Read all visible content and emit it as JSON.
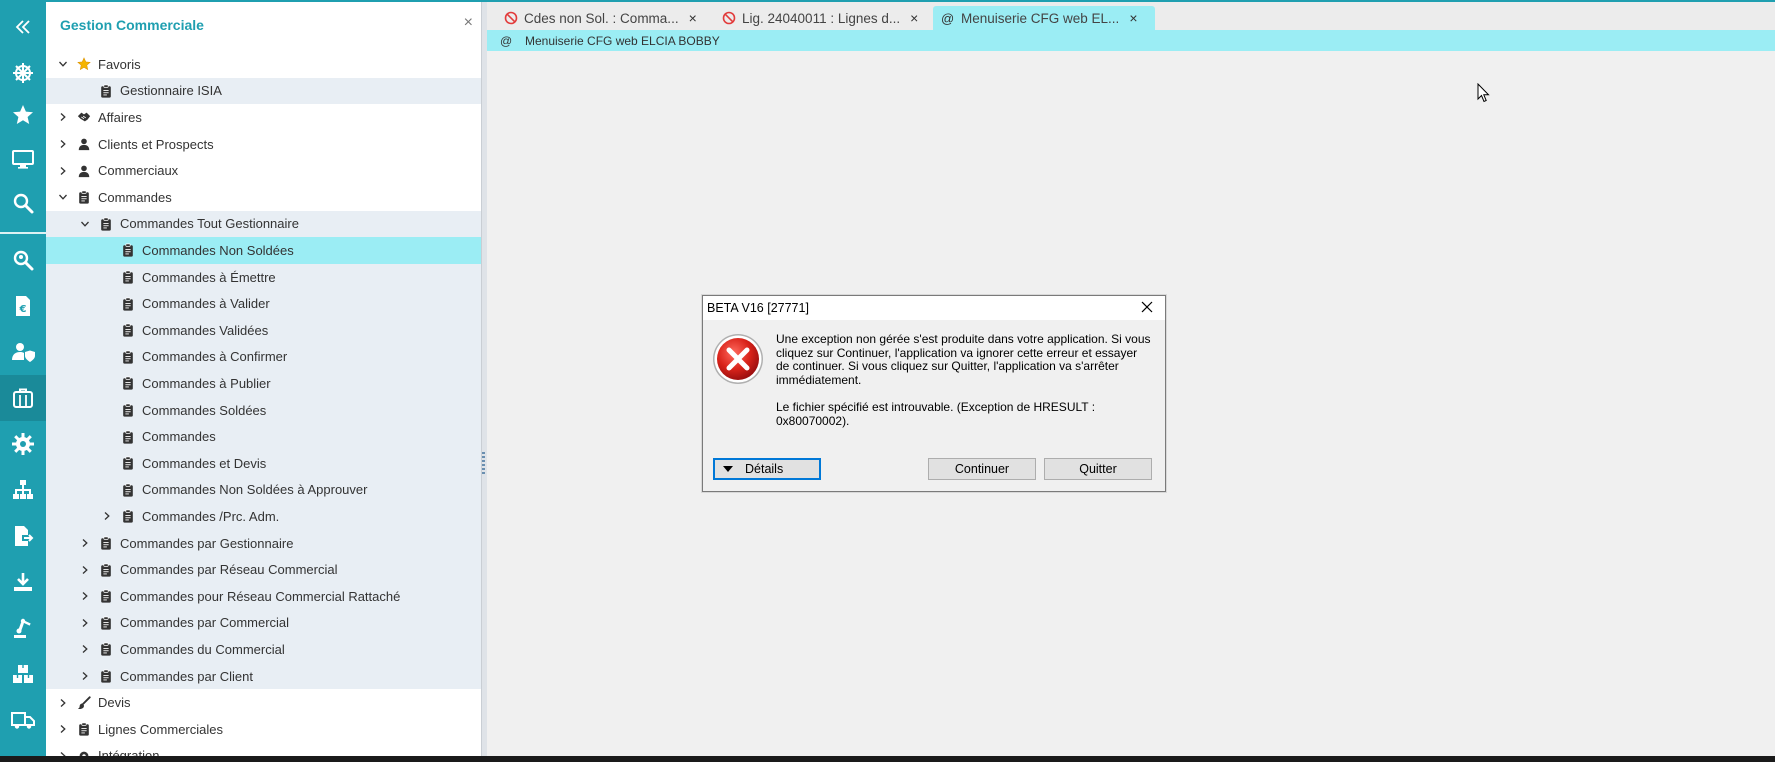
{
  "panel": {
    "title": "Gestion Commerciale",
    "close": "×",
    "tree": [
      {
        "label": "Favoris",
        "icon": "star-icon",
        "chev": "down",
        "indent": 0
      },
      {
        "label": "Gestionnaire ISIA",
        "icon": "clipboard-icon",
        "chev": "none",
        "indent": 1,
        "tinted": true
      },
      {
        "label": "Affaires",
        "icon": "handshake-icon",
        "chev": "right",
        "indent": 0
      },
      {
        "label": "Clients et Prospects",
        "icon": "person-icon",
        "chev": "right",
        "indent": 0
      },
      {
        "label": "Commerciaux",
        "icon": "person-icon",
        "chev": "right",
        "indent": 0
      },
      {
        "label": "Commandes",
        "icon": "clipboard-icon",
        "chev": "down",
        "indent": 0
      },
      {
        "label": "Commandes Tout Gestionnaire",
        "icon": "clipboard-icon",
        "chev": "down",
        "indent": 1,
        "tinted": true
      },
      {
        "label": "Commandes Non Soldées",
        "icon": "clipboard-icon",
        "chev": "none",
        "indent": 2,
        "selected": true
      },
      {
        "label": "Commandes à Émettre",
        "icon": "clipboard-icon",
        "chev": "none",
        "indent": 2,
        "tinted": true
      },
      {
        "label": "Commandes à Valider",
        "icon": "clipboard-icon",
        "chev": "none",
        "indent": 2,
        "tinted": true
      },
      {
        "label": "Commandes Validées",
        "icon": "clipboard-icon",
        "chev": "none",
        "indent": 2,
        "tinted": true
      },
      {
        "label": "Commandes à Confirmer",
        "icon": "clipboard-icon",
        "chev": "none",
        "indent": 2,
        "tinted": true
      },
      {
        "label": "Commandes à Publier",
        "icon": "clipboard-icon",
        "chev": "none",
        "indent": 2,
        "tinted": true
      },
      {
        "label": "Commandes Soldées",
        "icon": "clipboard-icon",
        "chev": "none",
        "indent": 2,
        "tinted": true
      },
      {
        "label": "Commandes",
        "icon": "clipboard-icon",
        "chev": "none",
        "indent": 2,
        "tinted": true
      },
      {
        "label": "Commandes et Devis",
        "icon": "clipboard-icon",
        "chev": "none",
        "indent": 2,
        "tinted": true
      },
      {
        "label": "Commandes Non Soldées à Approuver",
        "icon": "clipboard-icon",
        "chev": "none",
        "indent": 2,
        "tinted": true
      },
      {
        "label": "Commandes /Prc. Adm.",
        "icon": "clipboard-icon",
        "chev": "right",
        "indent": 2,
        "tinted": true
      },
      {
        "label": "Commandes par Gestionnaire",
        "icon": "clipboard-icon",
        "chev": "right",
        "indent": 1,
        "tinted": true
      },
      {
        "label": "Commandes par Réseau Commercial",
        "icon": "clipboard-icon",
        "chev": "right",
        "indent": 1,
        "tinted": true
      },
      {
        "label": "Commandes pour Réseau Commercial Rattaché",
        "icon": "clipboard-icon",
        "chev": "right",
        "indent": 1,
        "tinted": true
      },
      {
        "label": "Commandes par Commercial",
        "icon": "clipboard-icon",
        "chev": "right",
        "indent": 1,
        "tinted": true
      },
      {
        "label": "Commandes du Commercial",
        "icon": "clipboard-icon",
        "chev": "right",
        "indent": 1,
        "tinted": true
      },
      {
        "label": "Commandes par Client",
        "icon": "clipboard-icon",
        "chev": "right",
        "indent": 1,
        "tinted": true
      },
      {
        "label": "Devis",
        "icon": "brush-icon",
        "chev": "right",
        "indent": 0
      },
      {
        "label": "Lignes Commerciales",
        "icon": "clipboard-icon",
        "chev": "right",
        "indent": 0
      },
      {
        "label": "Intégration",
        "icon": "gear-icon",
        "chev": "right",
        "indent": 0
      }
    ]
  },
  "rail": {
    "items": [
      {
        "name": "collapse-icon"
      },
      {
        "name": "ship-wheel-icon"
      },
      {
        "name": "star-icon"
      },
      {
        "name": "monitor-icon"
      },
      {
        "name": "search-icon"
      },
      {
        "name": "location-search-icon"
      },
      {
        "name": "euro-document-icon"
      },
      {
        "name": "user-shield-icon"
      },
      {
        "name": "briefcase-icon",
        "active": true
      },
      {
        "name": "gear-icon"
      },
      {
        "name": "org-chart-icon"
      },
      {
        "name": "file-export-icon"
      },
      {
        "name": "download-icon"
      },
      {
        "name": "robot-arm-icon"
      },
      {
        "name": "boxes-icon"
      },
      {
        "name": "truck-icon"
      }
    ]
  },
  "tabs": [
    {
      "label": "Cdes non Sol. : Comma...",
      "icon": "blocked-icon",
      "close": "×"
    },
    {
      "label": "Lig. 24040011 : Lignes d...",
      "icon": "blocked-icon",
      "close": "×"
    },
    {
      "label": "Menuiserie CFG web EL...",
      "icon": "at-icon",
      "close": "×",
      "active": true
    }
  ],
  "tab_at_symbol": "@",
  "subbar": {
    "at": "@",
    "label": "Menuiserie CFG web ELCIA BOBBY"
  },
  "dialog": {
    "title": "BETA V16 [27771]",
    "message1": "Une exception non gérée s'est produite dans votre application. Si vous cliquez sur Continuer, l'application va ignorer cette erreur et essayer de continuer. Si vous cliquez sur Quitter, l'application va s'arrêter immédiatement.",
    "message2": "Le fichier spécifié est introuvable. (Exception de HRESULT : 0x80070002).",
    "details_button": "Détails",
    "continue_button": "Continuer",
    "quit_button": "Quitter"
  },
  "colors": {
    "accent": "#1f9fb0",
    "selected": "#9bedf4",
    "tinted": "#e8eef4",
    "error_red": "#d32f2f"
  }
}
